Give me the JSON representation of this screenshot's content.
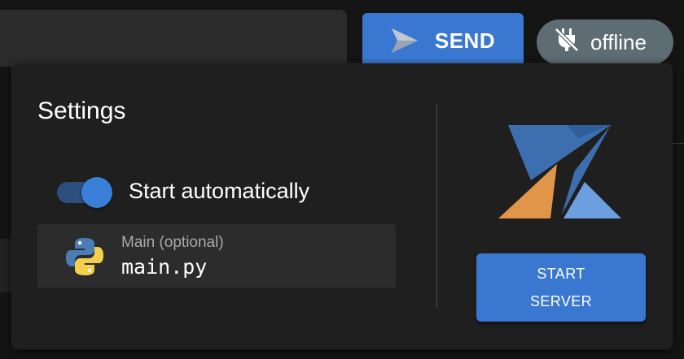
{
  "topbar": {
    "send_label": "SEND",
    "send_icon": "send-icon",
    "status_label": "offline",
    "status_icon": "power-plug-off-icon"
  },
  "settings": {
    "title": "Settings",
    "auto_start": {
      "label": "Start automatically",
      "enabled": true
    },
    "main_file": {
      "label": "Main (optional)",
      "value": "main.py",
      "icon": "python-icon"
    },
    "start_button": {
      "line1": "START",
      "line2": "SERVER"
    },
    "logo": "app-logo"
  },
  "colors": {
    "accent": "#3977d1",
    "status_chip": "#5e6c73",
    "panel_bg": "#1f1f1f",
    "logo_blue": "#3d6fb0",
    "logo_light_blue": "#6c9fe0",
    "logo_orange": "#e19548"
  }
}
